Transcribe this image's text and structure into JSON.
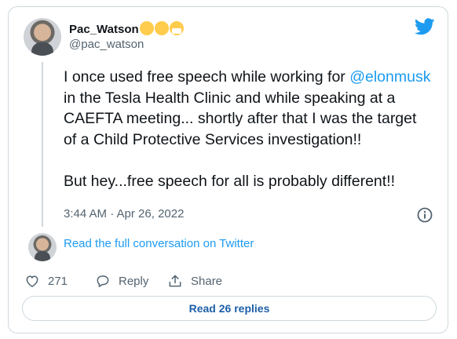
{
  "user": {
    "display_name": "Pac_Watson",
    "handle": "@pac_watson",
    "emojis": [
      "unamused-face-emoji",
      "face-with-thermometer-emoji",
      "face-with-medical-mask-emoji"
    ]
  },
  "tweet": {
    "text_line1": "I once used free speech while working for",
    "mention": "@elonmusk",
    "text_line2_rest": " in the Tesla Health Clinic and while speaking at a CAEFTA meeting... shortly after that I was the target of a Child Protective Services investigation!!",
    "text_para2": "But hey...free speech for all is probably different!!",
    "timestamp": "3:44 AM · Apr 26, 2022"
  },
  "conversation_link": "Read the full conversation on Twitter",
  "actions": {
    "like_count": "271",
    "reply_label": "Reply",
    "share_label": "Share"
  },
  "read_replies_label": "Read 26 replies",
  "colors": {
    "twitter_blue": "#1d9bf0",
    "muted_text": "#536471",
    "border": "#cfd9de"
  },
  "icons": [
    "twitter-bird-icon",
    "info-icon",
    "heart-icon",
    "reply-icon",
    "share-icon"
  ]
}
